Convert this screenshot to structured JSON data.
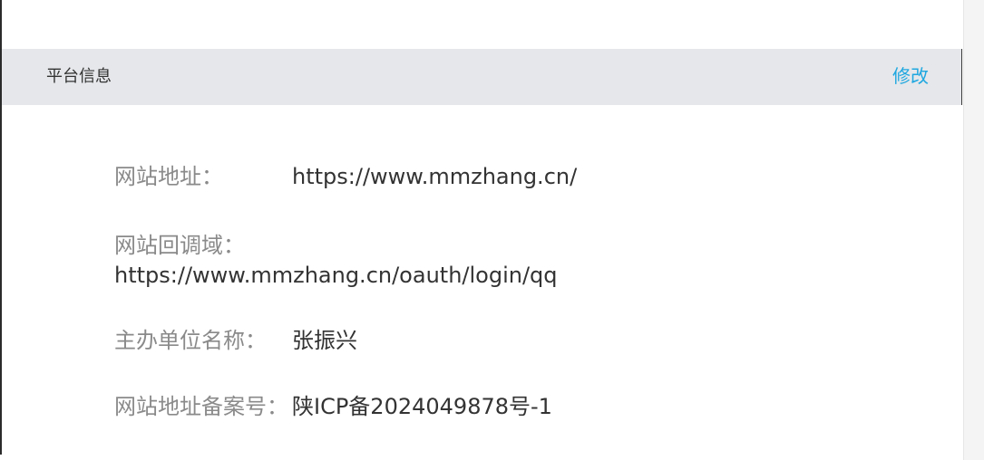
{
  "panel": {
    "title": "平台信息",
    "edit_label": "修改"
  },
  "info": {
    "site_url": {
      "label": "网站地址：",
      "value": "https://www.mmzhang.cn/"
    },
    "callback_domain": {
      "label": "网站回调域：",
      "value": "https://www.mmzhang.cn/oauth/login/qq"
    },
    "organizer_name": {
      "label": "主办单位名称：",
      "value": "张振兴"
    },
    "icp_number": {
      "label": "网站地址备案号：",
      "value": "陕ICP备2024049878号-1"
    }
  },
  "colors": {
    "header_bg": "#e5e7ea",
    "link": "#1ea7e0",
    "label": "#8a8a8a",
    "value": "#333333"
  }
}
